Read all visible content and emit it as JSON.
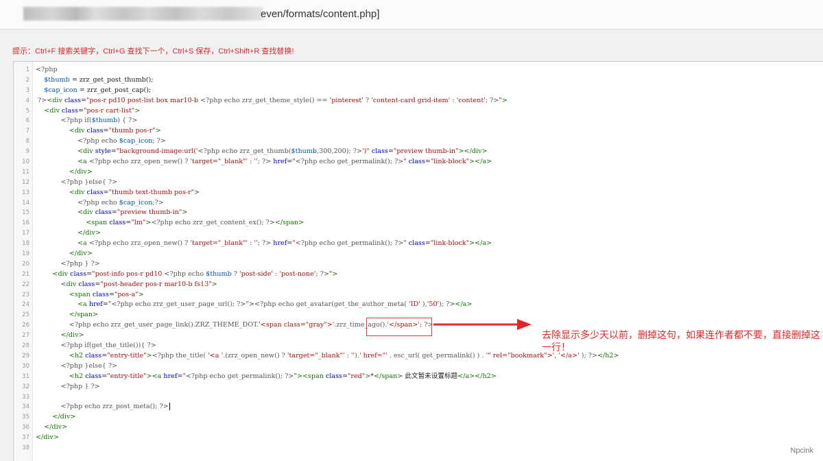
{
  "address_bar": {
    "path": "even/formats/content.php]"
  },
  "hint": "提示：Ctrl+F 搜索关键字，Ctrl+G 查找下一个，Ctrl+S 保存，Ctrl+Shift+R 查找替换!",
  "colors": {
    "hint": "#e4252a",
    "annotation": "#e4252a",
    "box": "#e23b3b"
  },
  "code": [
    {
      "n": "1",
      "segs": [
        {
          "c": "php",
          "t": "<?php"
        }
      ]
    },
    {
      "n": "2",
      "segs": [
        {
          "c": "txt",
          "t": "    "
        },
        {
          "c": "var",
          "t": "$thumb"
        },
        {
          "c": "txt",
          "t": " = zrz_get_post_thumb();"
        }
      ]
    },
    {
      "n": "3",
      "segs": [
        {
          "c": "txt",
          "t": "    "
        },
        {
          "c": "var",
          "t": "$cap_icon"
        },
        {
          "c": "txt",
          "t": " = zrz_get_post_cap();"
        }
      ]
    },
    {
      "n": "4",
      "segs": [
        {
          "c": "php",
          "t": " ?>"
        },
        {
          "c": "tag",
          "t": "<div "
        },
        {
          "c": "attr",
          "t": "class"
        },
        {
          "c": "txt",
          "t": "="
        },
        {
          "c": "str",
          "t": "\"pos-r pd10 post-list box mar10-b "
        },
        {
          "c": "php",
          "t": "<?php echo zrz_get_theme_style() == "
        },
        {
          "c": "str",
          "t": "'pinterest'"
        },
        {
          "c": "php",
          "t": " ? "
        },
        {
          "c": "str",
          "t": "'content-card grid-item'"
        },
        {
          "c": "php",
          "t": " : "
        },
        {
          "c": "str",
          "t": "'content'"
        },
        {
          "c": "php",
          "t": "; ?>"
        },
        {
          "c": "str",
          "t": "\""
        },
        {
          "c": "tag",
          "t": ">"
        }
      ]
    },
    {
      "n": "5",
      "segs": [
        {
          "c": "txt",
          "t": "    "
        },
        {
          "c": "tag",
          "t": "<div "
        },
        {
          "c": "attr",
          "t": "class"
        },
        {
          "c": "txt",
          "t": "="
        },
        {
          "c": "str",
          "t": "\"pos-r cart-list\""
        },
        {
          "c": "tag",
          "t": ">"
        }
      ]
    },
    {
      "n": "6",
      "segs": [
        {
          "c": "txt",
          "t": "            "
        },
        {
          "c": "php",
          "t": "<?php if("
        },
        {
          "c": "var",
          "t": "$thumb"
        },
        {
          "c": "php",
          "t": ") { ?>"
        }
      ]
    },
    {
      "n": "7",
      "segs": [
        {
          "c": "txt",
          "t": "                "
        },
        {
          "c": "tag",
          "t": "<div "
        },
        {
          "c": "attr",
          "t": "class"
        },
        {
          "c": "txt",
          "t": "="
        },
        {
          "c": "str",
          "t": "\"thumb pos-r\""
        },
        {
          "c": "tag",
          "t": ">"
        }
      ]
    },
    {
      "n": "8",
      "segs": [
        {
          "c": "txt",
          "t": "                    "
        },
        {
          "c": "php",
          "t": "<?php echo "
        },
        {
          "c": "var",
          "t": "$cap_icon"
        },
        {
          "c": "php",
          "t": "; ?>"
        }
      ]
    },
    {
      "n": "9",
      "segs": [
        {
          "c": "txt",
          "t": "                    "
        },
        {
          "c": "tag",
          "t": "<div "
        },
        {
          "c": "attr",
          "t": "style"
        },
        {
          "c": "txt",
          "t": "="
        },
        {
          "c": "str",
          "t": "\"background-image:url('"
        },
        {
          "c": "php",
          "t": "<?php echo zrz_get_thumb("
        },
        {
          "c": "var",
          "t": "$thumb"
        },
        {
          "c": "php",
          "t": ",300,200); ?>"
        },
        {
          "c": "str",
          "t": "')\""
        },
        {
          "c": "txt",
          "t": " "
        },
        {
          "c": "attr",
          "t": "class"
        },
        {
          "c": "txt",
          "t": "="
        },
        {
          "c": "str",
          "t": "\"preview thumb-in\""
        },
        {
          "c": "tag",
          "t": "></div>"
        }
      ]
    },
    {
      "n": "10",
      "segs": [
        {
          "c": "txt",
          "t": "                    "
        },
        {
          "c": "tag",
          "t": "<a "
        },
        {
          "c": "php",
          "t": "<?php echo zrz_open_new() ? "
        },
        {
          "c": "str",
          "t": "'target=\"_blank\"'"
        },
        {
          "c": "php",
          "t": " : "
        },
        {
          "c": "str",
          "t": "''"
        },
        {
          "c": "php",
          "t": "; ?> "
        },
        {
          "c": "attr",
          "t": "href"
        },
        {
          "c": "txt",
          "t": "="
        },
        {
          "c": "str",
          "t": "\""
        },
        {
          "c": "php",
          "t": "<?php echo get_permalink(); ?>"
        },
        {
          "c": "str",
          "t": "\""
        },
        {
          "c": "txt",
          "t": " "
        },
        {
          "c": "attr",
          "t": "class"
        },
        {
          "c": "txt",
          "t": "="
        },
        {
          "c": "str",
          "t": "\"link-block\""
        },
        {
          "c": "tag",
          "t": "></a>"
        }
      ]
    },
    {
      "n": "11",
      "segs": [
        {
          "c": "txt",
          "t": "                "
        },
        {
          "c": "tag",
          "t": "</div>"
        }
      ]
    },
    {
      "n": "12",
      "segs": [
        {
          "c": "txt",
          "t": "            "
        },
        {
          "c": "php",
          "t": "<?php }else{ ?>"
        }
      ]
    },
    {
      "n": "13",
      "segs": [
        {
          "c": "txt",
          "t": "                "
        },
        {
          "c": "tag",
          "t": "<div "
        },
        {
          "c": "attr",
          "t": "class"
        },
        {
          "c": "txt",
          "t": "="
        },
        {
          "c": "str",
          "t": "\"thumb text-thumb pos-r\""
        },
        {
          "c": "tag",
          "t": ">"
        }
      ]
    },
    {
      "n": "14",
      "segs": [
        {
          "c": "txt",
          "t": "                    "
        },
        {
          "c": "php",
          "t": "<?php echo "
        },
        {
          "c": "var",
          "t": "$cap_icon"
        },
        {
          "c": "php",
          "t": ";?>"
        }
      ]
    },
    {
      "n": "15",
      "segs": [
        {
          "c": "txt",
          "t": "                    "
        },
        {
          "c": "tag",
          "t": "<div "
        },
        {
          "c": "attr",
          "t": "class"
        },
        {
          "c": "txt",
          "t": "="
        },
        {
          "c": "str",
          "t": "\"preview thumb-in\""
        },
        {
          "c": "tag",
          "t": ">"
        }
      ]
    },
    {
      "n": "16",
      "segs": [
        {
          "c": "txt",
          "t": "                        "
        },
        {
          "c": "tag",
          "t": "<span "
        },
        {
          "c": "attr",
          "t": "class"
        },
        {
          "c": "txt",
          "t": "="
        },
        {
          "c": "str",
          "t": "\"lm\""
        },
        {
          "c": "tag",
          "t": ">"
        },
        {
          "c": "php",
          "t": "<?php echo zrz_get_content_ex(); ?>"
        },
        {
          "c": "tag",
          "t": "</span>"
        }
      ]
    },
    {
      "n": "17",
      "segs": [
        {
          "c": "txt",
          "t": "                    "
        },
        {
          "c": "tag",
          "t": "</div>"
        }
      ]
    },
    {
      "n": "18",
      "segs": [
        {
          "c": "txt",
          "t": "                    "
        },
        {
          "c": "tag",
          "t": "<a "
        },
        {
          "c": "php",
          "t": "<?php echo zrz_open_new() ? "
        },
        {
          "c": "str",
          "t": "'target=\"_blank\"'"
        },
        {
          "c": "php",
          "t": " : "
        },
        {
          "c": "str",
          "t": "''"
        },
        {
          "c": "php",
          "t": "; ?> "
        },
        {
          "c": "attr",
          "t": "href"
        },
        {
          "c": "txt",
          "t": "="
        },
        {
          "c": "str",
          "t": "\""
        },
        {
          "c": "php",
          "t": "<?php echo get_permalink(); ?>"
        },
        {
          "c": "str",
          "t": "\""
        },
        {
          "c": "txt",
          "t": " "
        },
        {
          "c": "attr",
          "t": "class"
        },
        {
          "c": "txt",
          "t": "="
        },
        {
          "c": "str",
          "t": "\"link-block\""
        },
        {
          "c": "tag",
          "t": "></a>"
        }
      ]
    },
    {
      "n": "19",
      "segs": [
        {
          "c": "txt",
          "t": "                "
        },
        {
          "c": "tag",
          "t": "</div>"
        }
      ]
    },
    {
      "n": "20",
      "segs": [
        {
          "c": "txt",
          "t": "            "
        },
        {
          "c": "php",
          "t": "<?php } ?>"
        }
      ]
    },
    {
      "n": "21",
      "segs": [
        {
          "c": "txt",
          "t": "        "
        },
        {
          "c": "tag",
          "t": "<div "
        },
        {
          "c": "attr",
          "t": "class"
        },
        {
          "c": "txt",
          "t": "="
        },
        {
          "c": "str",
          "t": "\"post-info pos-r pd10 "
        },
        {
          "c": "php",
          "t": "<?php echo "
        },
        {
          "c": "var",
          "t": "$thumb"
        },
        {
          "c": "php",
          "t": " ? "
        },
        {
          "c": "str",
          "t": "'post-side'"
        },
        {
          "c": "php",
          "t": " : "
        },
        {
          "c": "str",
          "t": "'post-none'"
        },
        {
          "c": "php",
          "t": "; ?>"
        },
        {
          "c": "str",
          "t": "\""
        },
        {
          "c": "tag",
          "t": ">"
        }
      ]
    },
    {
      "n": "22",
      "segs": [
        {
          "c": "txt",
          "t": "            "
        },
        {
          "c": "tag",
          "t": "<div "
        },
        {
          "c": "attr",
          "t": "class"
        },
        {
          "c": "txt",
          "t": "="
        },
        {
          "c": "str",
          "t": "\"post-header pos-r mar10-b fs13\""
        },
        {
          "c": "tag",
          "t": ">"
        }
      ]
    },
    {
      "n": "23",
      "segs": [
        {
          "c": "txt",
          "t": "                "
        },
        {
          "c": "tag",
          "t": "<span "
        },
        {
          "c": "attr",
          "t": "class"
        },
        {
          "c": "txt",
          "t": "="
        },
        {
          "c": "str",
          "t": "\"pos-a\""
        },
        {
          "c": "tag",
          "t": ">"
        }
      ]
    },
    {
      "n": "24",
      "segs": [
        {
          "c": "txt",
          "t": "                    "
        },
        {
          "c": "tag",
          "t": "<a "
        },
        {
          "c": "attr",
          "t": "href"
        },
        {
          "c": "txt",
          "t": "="
        },
        {
          "c": "str",
          "t": "\""
        },
        {
          "c": "php",
          "t": "<?php echo zrz_get_user_page_url(); ?>"
        },
        {
          "c": "str",
          "t": "\""
        },
        {
          "c": "tag",
          "t": ">"
        },
        {
          "c": "php",
          "t": "<?php echo get_avatar(get_the_author_meta( "
        },
        {
          "c": "str",
          "t": "'ID'"
        },
        {
          "c": "php",
          "t": " ),"
        },
        {
          "c": "str",
          "t": "'50'"
        },
        {
          "c": "php",
          "t": "); ?>"
        },
        {
          "c": "tag",
          "t": "</a>"
        }
      ]
    },
    {
      "n": "25",
      "segs": [
        {
          "c": "txt",
          "t": "                "
        },
        {
          "c": "tag",
          "t": "</span>"
        }
      ]
    },
    {
      "n": "26",
      "segs": [
        {
          "c": "txt",
          "t": "                "
        },
        {
          "c": "php",
          "t": "<?php echo zrz_get_user_page_link().ZRZ_THEME_DOT."
        },
        {
          "c": "str",
          "t": "'<span class=\"gray\">'"
        },
        {
          "c": "php",
          "t": ".zrz_time_ago()."
        },
        {
          "c": "str",
          "t": "'</span>'"
        },
        {
          "c": "php",
          "t": "; ?>"
        }
      ]
    },
    {
      "n": "27",
      "segs": [
        {
          "c": "txt",
          "t": "            "
        },
        {
          "c": "tag",
          "t": "</div>"
        }
      ]
    },
    {
      "n": "28",
      "segs": [
        {
          "c": "txt",
          "t": "            "
        },
        {
          "c": "php",
          "t": "<?php if(get_the_title()){ ?>"
        }
      ]
    },
    {
      "n": "29",
      "segs": [
        {
          "c": "txt",
          "t": "                "
        },
        {
          "c": "tag",
          "t": "<h2 "
        },
        {
          "c": "attr",
          "t": "class"
        },
        {
          "c": "txt",
          "t": "="
        },
        {
          "c": "str",
          "t": "\"entry-title\""
        },
        {
          "c": "tag",
          "t": ">"
        },
        {
          "c": "php",
          "t": "<?php the_title( "
        },
        {
          "c": "str",
          "t": "'<a '"
        },
        {
          "c": "php",
          "t": ".(zrz_open_new() ? "
        },
        {
          "c": "str",
          "t": "'target=\"_blank\"'"
        },
        {
          "c": "php",
          "t": " : "
        },
        {
          "c": "str",
          "t": "''"
        },
        {
          "c": "php",
          "t": ")."
        },
        {
          "c": "str",
          "t": "' href=\"'"
        },
        {
          "c": "php",
          "t": " . esc_url( get_permalink() ) . "
        },
        {
          "c": "str",
          "t": "'\" rel=\"bookmark\">'"
        },
        {
          "c": "php",
          "t": ", "
        },
        {
          "c": "str",
          "t": "'</a>'"
        },
        {
          "c": "php",
          "t": " ); ?>"
        },
        {
          "c": "tag",
          "t": "</h2>"
        }
      ]
    },
    {
      "n": "30",
      "segs": [
        {
          "c": "txt",
          "t": "            "
        },
        {
          "c": "php",
          "t": "<?php }else{ ?>"
        }
      ]
    },
    {
      "n": "31",
      "segs": [
        {
          "c": "txt",
          "t": "                "
        },
        {
          "c": "tag",
          "t": "<h2 "
        },
        {
          "c": "attr",
          "t": "class"
        },
        {
          "c": "txt",
          "t": "="
        },
        {
          "c": "str",
          "t": "\"entry-title\""
        },
        {
          "c": "tag",
          "t": "><a "
        },
        {
          "c": "attr",
          "t": "href"
        },
        {
          "c": "txt",
          "t": "="
        },
        {
          "c": "str",
          "t": "\""
        },
        {
          "c": "php",
          "t": "<?php echo get_permalink(); ?>"
        },
        {
          "c": "str",
          "t": "\""
        },
        {
          "c": "tag",
          "t": "><span "
        },
        {
          "c": "attr",
          "t": "class"
        },
        {
          "c": "txt",
          "t": "="
        },
        {
          "c": "str",
          "t": "\"red\""
        },
        {
          "c": "tag",
          "t": ">"
        },
        {
          "c": "txt",
          "t": "*"
        },
        {
          "c": "tag",
          "t": "</span>"
        },
        {
          "c": "txt",
          "t": " 此文暂未设置标题"
        },
        {
          "c": "tag",
          "t": "</a></h2>"
        }
      ]
    },
    {
      "n": "32",
      "segs": [
        {
          "c": "txt",
          "t": "            "
        },
        {
          "c": "php",
          "t": "<?php } ?>"
        }
      ]
    },
    {
      "n": "33",
      "segs": []
    },
    {
      "n": "34",
      "segs": [
        {
          "c": "txt",
          "t": "            "
        },
        {
          "c": "php",
          "t": "<?php echo zrz_post_meta(); ?>"
        },
        {
          "c": "cursor",
          "t": ""
        }
      ]
    },
    {
      "n": "35",
      "segs": [
        {
          "c": "txt",
          "t": "        "
        },
        {
          "c": "tag",
          "t": "</div>"
        }
      ]
    },
    {
      "n": "36",
      "segs": [
        {
          "c": "txt",
          "t": "    "
        },
        {
          "c": "tag",
          "t": "</div>"
        }
      ]
    },
    {
      "n": "37",
      "segs": [
        {
          "c": "tag",
          "t": "</div>"
        }
      ]
    },
    {
      "n": "38",
      "segs": []
    }
  ],
  "annotation": {
    "text": "去除显示多少天以前，删掉这句，如果连作者都不要，直接删掉这一行！"
  },
  "watermark": "Npcink"
}
